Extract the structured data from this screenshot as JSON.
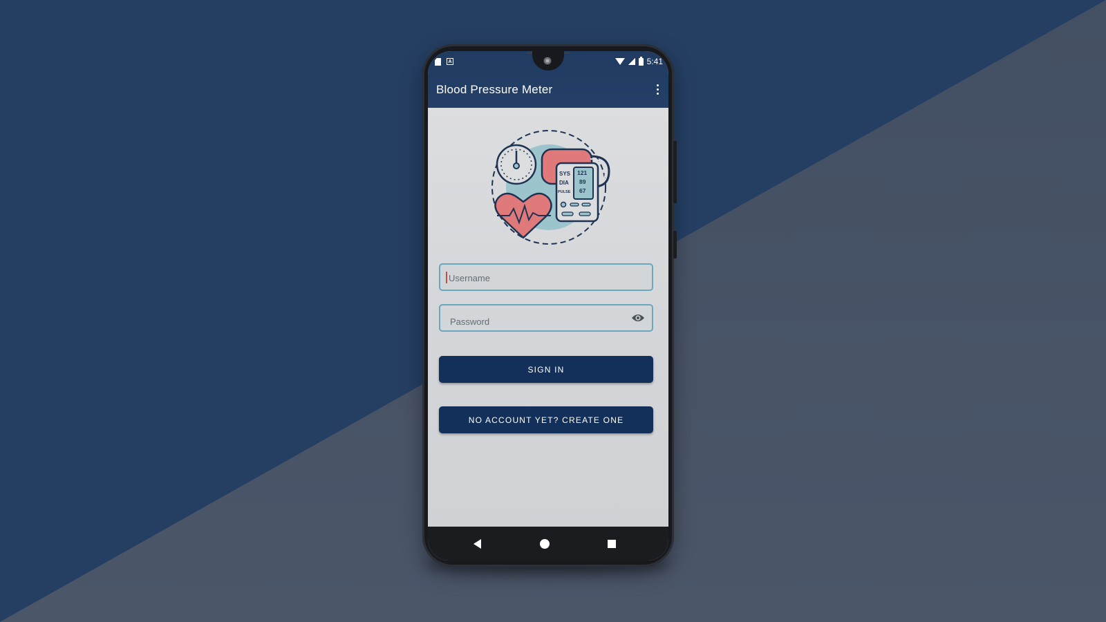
{
  "colors": {
    "background_dark": "#253f63",
    "background_slate": "#4a5568",
    "app_bar": "#233e65",
    "button": "#13305a",
    "field_border": "#6aa7be",
    "heart": "#e07a7a",
    "accent_teal": "#9cc4cc"
  },
  "status_bar": {
    "time": "5:41",
    "left_icons": [
      "sim-card-icon",
      "a-notification-icon"
    ],
    "right_icons": [
      "wifi-icon",
      "signal-icon",
      "battery-icon"
    ]
  },
  "app_bar": {
    "title": "Blood Pressure Meter",
    "menu_icon": "more-vert-icon"
  },
  "illustration": {
    "labels": [
      "SYS",
      "DIA",
      "PULSE"
    ],
    "values": [
      "121",
      "89",
      "67"
    ]
  },
  "form": {
    "username_placeholder": "Username",
    "username_value": "",
    "password_placeholder": "Password",
    "password_value": "",
    "password_toggle_icon": "eye-icon",
    "sign_in_label": "SIGN IN",
    "create_account_label": "NO ACCOUNT YET? CREATE ONE"
  },
  "nav_bar": {
    "icons": [
      "back-icon",
      "home-icon",
      "recents-icon"
    ]
  }
}
